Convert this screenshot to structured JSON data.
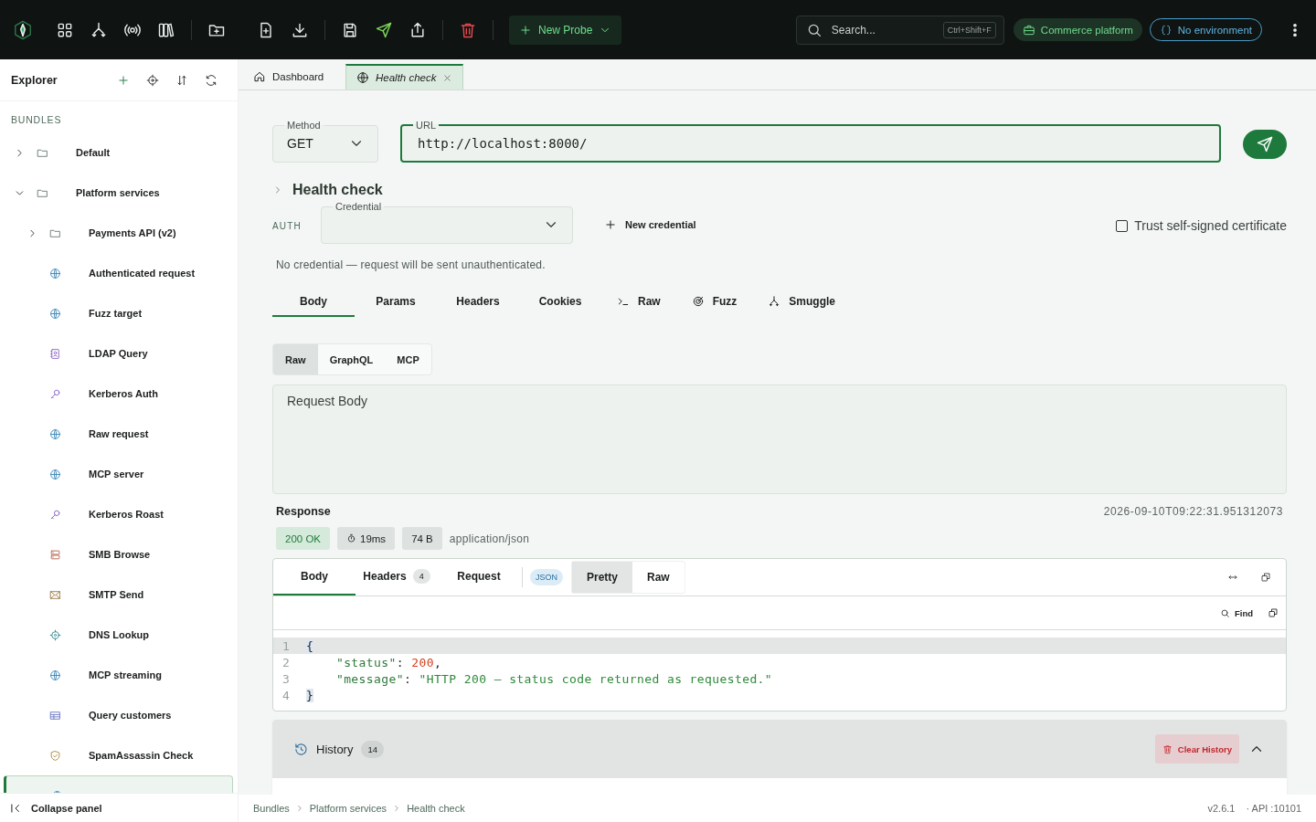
{
  "topbar": {
    "new_probe": "New Probe",
    "search": {
      "placeholder": "Search...",
      "shortcut": "Ctrl+Shift+F"
    },
    "workspace": "Commerce platform",
    "environment": "No environment"
  },
  "sidebar": {
    "title": "Explorer",
    "section": "BUNDLES",
    "items": [
      {
        "label": "Default",
        "kind": "folder",
        "expanded": false,
        "selected": false
      },
      {
        "label": "Platform services",
        "kind": "folder",
        "expanded": true,
        "selected": false,
        "children": [
          {
            "label": "Payments API (v2)",
            "kind": "folder",
            "expanded": false,
            "selected": false
          },
          {
            "label": "Authenticated request",
            "kind": "request",
            "selected": false
          },
          {
            "label": "Fuzz target",
            "kind": "request",
            "selected": false
          },
          {
            "label": "LDAP Query",
            "kind": "ldap",
            "selected": false
          },
          {
            "label": "Kerberos Auth",
            "kind": "kerberos",
            "selected": false
          },
          {
            "label": "Raw request",
            "kind": "request",
            "selected": false
          },
          {
            "label": "MCP server",
            "kind": "request",
            "selected": false
          },
          {
            "label": "Kerberos Roast",
            "kind": "kerberos",
            "selected": false
          },
          {
            "label": "SMB Browse",
            "kind": "smb",
            "selected": false
          },
          {
            "label": "SMTP Send",
            "kind": "smtp",
            "selected": false
          },
          {
            "label": "DNS Lookup",
            "kind": "dns",
            "selected": false
          },
          {
            "label": "MCP streaming",
            "kind": "request",
            "selected": false
          },
          {
            "label": "Query customers",
            "kind": "query",
            "selected": false
          },
          {
            "label": "SpamAssassin Check",
            "kind": "spam",
            "selected": false
          },
          {
            "kind": "request",
            "selected": true
          }
        ]
      }
    ],
    "collapse": "Collapse panel"
  },
  "tabs": [
    {
      "label": "Dashboard",
      "selected": false
    },
    {
      "label": "Health check",
      "selected": true
    }
  ],
  "request": {
    "method_label": "Method",
    "method": "GET",
    "url_label": "URL",
    "url": "http://localhost:8000/",
    "name": "Health check",
    "auth_label": "AUTH",
    "credential_label": "Credential",
    "new_credential": "New credential",
    "trust": {
      "label": "Trust self-signed certificate",
      "checked": false
    },
    "note": "No credential — request will be sent unauthenticated.",
    "tabs": [
      {
        "label": "Body",
        "selected": true
      },
      {
        "label": "Params",
        "selected": false
      },
      {
        "label": "Headers",
        "selected": false
      },
      {
        "label": "Cookies",
        "selected": false
      },
      {
        "label": "Raw",
        "selected": false
      },
      {
        "label": "Fuzz",
        "selected": false
      },
      {
        "label": "Smuggle",
        "selected": false
      }
    ],
    "body_modes": [
      {
        "label": "Raw",
        "selected": true
      },
      {
        "label": "GraphQL",
        "selected": false
      },
      {
        "label": "MCP",
        "selected": false
      }
    ],
    "body_placeholder": "Request Body"
  },
  "response": {
    "title": "Response",
    "timestamp": "2026-09-10T09:22:31.951312073",
    "status": "200 OK",
    "time": "19ms",
    "size": "74 B",
    "content_type": "application/json",
    "tabs": [
      {
        "label": "Body",
        "selected": true
      },
      {
        "label": "Headers",
        "count": "4",
        "selected": false
      },
      {
        "label": "Request",
        "selected": false
      }
    ],
    "format": "JSON",
    "views": [
      {
        "label": "Pretty",
        "selected": true
      },
      {
        "label": "Raw",
        "selected": false
      }
    ],
    "find": "Find",
    "lines": [
      {
        "n": "1",
        "active": true,
        "tokens": [
          {
            "kind": "brace",
            "text": "{"
          }
        ]
      },
      {
        "n": "2",
        "active": false,
        "tokens": [
          {
            "kind": "key",
            "text": "    \"status\""
          },
          {
            "kind": "punct",
            "text": ": "
          },
          {
            "kind": "number",
            "text": "200"
          },
          {
            "kind": "punct",
            "text": ","
          }
        ]
      },
      {
        "n": "3",
        "active": false,
        "tokens": [
          {
            "kind": "key",
            "text": "    \"message\""
          },
          {
            "kind": "punct",
            "text": ": "
          },
          {
            "kind": "string",
            "text": "\"HTTP 200 — status code returned as requested.\""
          }
        ]
      },
      {
        "n": "4",
        "active": false,
        "tokens": [
          {
            "kind": "brace",
            "text": "}"
          }
        ]
      }
    ]
  },
  "history": {
    "title": "History",
    "count": "14",
    "clear": "Clear History",
    "expanded": true
  },
  "status_bar": {
    "breadcrumbs": [
      "Bundles",
      "Platform services",
      "Health check"
    ],
    "version": "v2.6.1",
    "api": "· API :10101"
  }
}
